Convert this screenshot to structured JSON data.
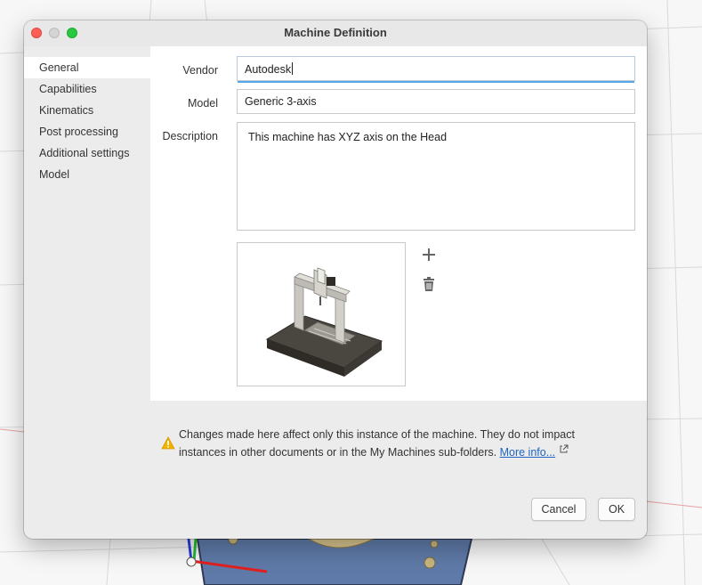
{
  "window": {
    "title": "Machine Definition"
  },
  "sidebar": {
    "items": [
      {
        "label": "General",
        "active": true
      },
      {
        "label": "Capabilities",
        "active": false
      },
      {
        "label": "Kinematics",
        "active": false
      },
      {
        "label": "Post processing",
        "active": false
      },
      {
        "label": "Additional settings",
        "active": false
      },
      {
        "label": "Model",
        "active": false
      }
    ]
  },
  "form": {
    "vendor": {
      "label": "Vendor",
      "value": "Autodesk"
    },
    "model": {
      "label": "Model",
      "value": "Generic 3-axis"
    },
    "description": {
      "label": "Description",
      "value": "This machine has XYZ axis on the Head"
    },
    "image": {
      "icon": "machine-thumbnail"
    },
    "add_icon": "plus-icon",
    "delete_icon": "trash-icon"
  },
  "notice": {
    "icon": "warning-icon",
    "line1": "Changes made here affect only this instance of the machine. They do not impact",
    "line2": "instances in other documents or in the My Machines sub-folders.",
    "link": "More info..."
  },
  "buttons": {
    "cancel": "Cancel",
    "ok": "OK"
  },
  "colors": {
    "accent": "#5aa7e8",
    "link": "#1f64c2",
    "warning": "#f2b200"
  }
}
